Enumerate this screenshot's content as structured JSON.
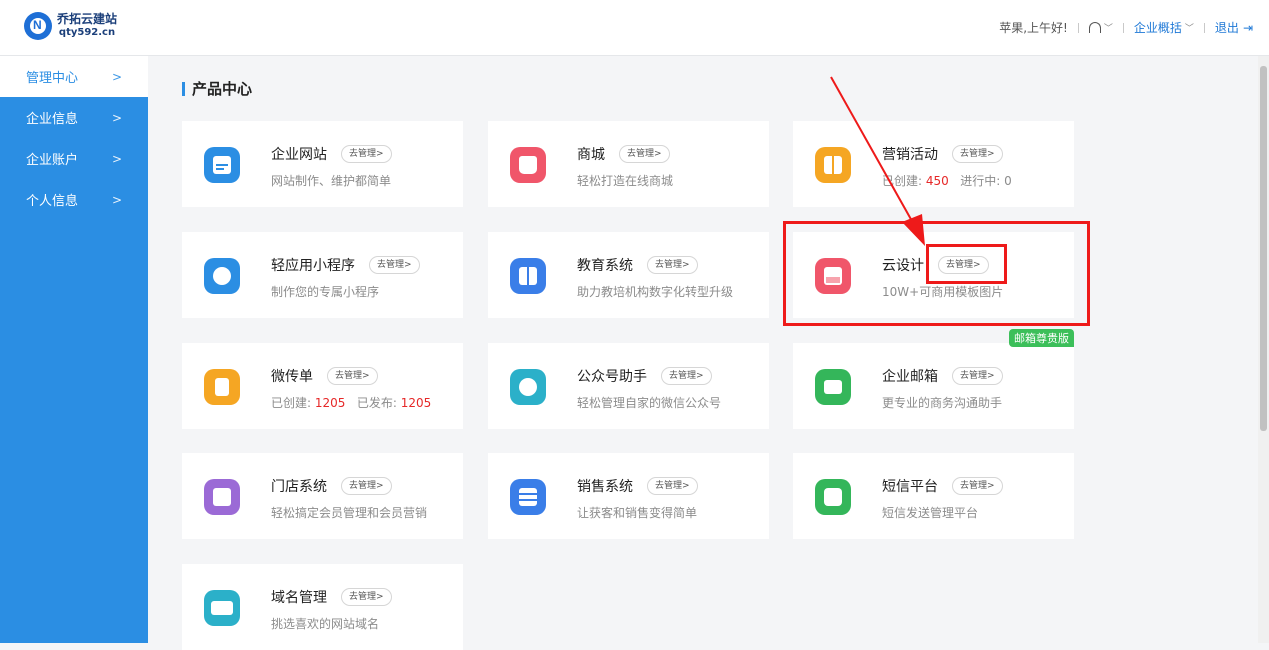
{
  "header": {
    "logo_name": "乔拓云建站",
    "logo_domain": "qty592.cn",
    "greeting": "苹果,上午好!",
    "overview": "企业概括",
    "logout": "退出"
  },
  "sidebar": {
    "items": [
      {
        "label": "管理中心"
      },
      {
        "label": "企业信息"
      },
      {
        "label": "企业账户"
      },
      {
        "label": "个人信息"
      }
    ]
  },
  "main": {
    "section_title": "产品中心",
    "manage_label": "去管理>",
    "cards": [
      {
        "title": "企业网站",
        "desc": "网站制作、维护都简单",
        "color": "#2b8ee3",
        "icon": "browser-icon"
      },
      {
        "title": "商城",
        "desc": "轻松打造在线商城",
        "color": "#f0566a",
        "icon": "shopping-bag-icon"
      },
      {
        "title": "营销活动",
        "desc_pre": "已创建:",
        "created": "450",
        "desc_mid": "进行中:",
        "ongoing": "0",
        "color": "#f5a623",
        "icon": "gift-icon"
      },
      {
        "title": "轻应用小程序",
        "desc": "制作您的专属小程序",
        "color": "#2b8ee3",
        "icon": "mini-program-icon"
      },
      {
        "title": "教育系统",
        "desc": "助力教培机构数字化转型升级",
        "color": "#3a7ee8",
        "icon": "book-icon"
      },
      {
        "title": "云设计",
        "desc": "10W+可商用模板图片",
        "color": "#f0566a",
        "icon": "image-icon"
      },
      {
        "title": "微传单",
        "desc_pre": "已创建:",
        "created": "1205",
        "desc_mid": "已发布:",
        "published": "1205",
        "color": "#f5a623",
        "icon": "flyer-icon"
      },
      {
        "title": "公众号助手",
        "desc": "轻松管理自家的微信公众号",
        "color": "#2bb0c9",
        "icon": "wechat-icon"
      },
      {
        "title": "企业邮箱",
        "desc": "更专业的商务沟通助手",
        "badge": "邮箱尊贵版",
        "color": "#34b65a",
        "icon": "mail-icon"
      },
      {
        "title": "门店系统",
        "desc": "轻松搞定会员管理和会员营销",
        "color": "#9b6ad6",
        "icon": "store-icon"
      },
      {
        "title": "销售系统",
        "desc": "让获客和销售变得简单",
        "color": "#3a7ee8",
        "icon": "list-icon"
      },
      {
        "title": "短信平台",
        "desc": "短信发送管理平台",
        "color": "#34b65a",
        "icon": "message-icon"
      },
      {
        "title": "域名管理",
        "desc": "挑选喜欢的网站域名",
        "color": "#2bb0c9",
        "icon": "domain-icon"
      }
    ]
  }
}
